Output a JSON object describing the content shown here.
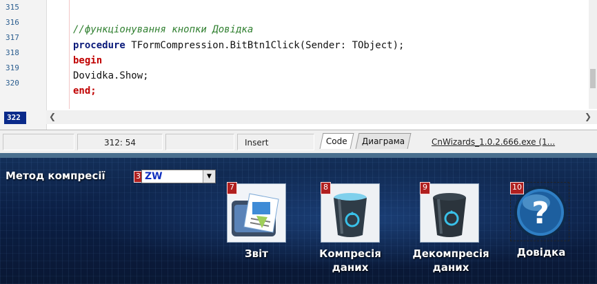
{
  "editor": {
    "line_numbers": [
      "315",
      "316",
      "317",
      "318",
      "319",
      "320",
      "322"
    ],
    "current_line": "322",
    "code": {
      "comment": "//функціонування кнопки Довідка",
      "proc_keyword": "procedure",
      "proc_rest": " TFormCompression.BitBtn1Click(Sender: TObject);",
      "begin": "begin",
      "show_call": "Dovidka.Show;",
      "end": "end;"
    }
  },
  "statusbar": {
    "position": "312: 54",
    "mode": "Insert",
    "tab_code": "Code",
    "tab_diagram": "Диаграма",
    "file": "CnWizards_1.0.2.666.exe (1..."
  },
  "app": {
    "method_label": "Метод компресії",
    "method_badge": "3",
    "method_value": "ZW",
    "buttons": [
      {
        "badge": "7",
        "label": "Звіт",
        "icon": "report-icon"
      },
      {
        "badge": "8",
        "label": "Компресія даних",
        "label1": "Компресія",
        "label2": "даних",
        "icon": "recycle-bin-icon"
      },
      {
        "badge": "9",
        "label": "Декомпресія даних",
        "label1": "Декомпресія",
        "label2": "даних",
        "icon": "recycle-bin-icon"
      },
      {
        "badge": "10",
        "label": "Довідка",
        "icon": "help-icon"
      }
    ]
  },
  "colors": {
    "panel_dark": "#0b1f45",
    "code_keyword": "#0a1a7a",
    "code_comment": "#2f7f2f",
    "code_red_keyword": "#c00000",
    "badge_red": "#b02020",
    "combo_text": "#1030c0"
  }
}
